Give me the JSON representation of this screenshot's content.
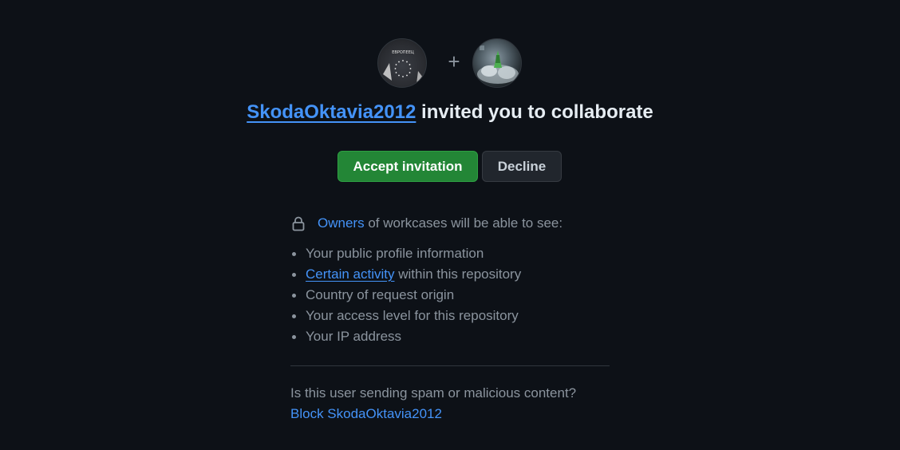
{
  "invite": {
    "inviter": "SkodaOktavia2012",
    "title_rest": "invited you to collaborate",
    "plus_symbol": "+",
    "inviter_avatar_text": "ЕВРОПЕЕЦ"
  },
  "actions": {
    "accept_label": "Accept invitation",
    "decline_label": "Decline"
  },
  "visibility": {
    "owners_link": "Owners",
    "owners_text": "of workcases will be able to see:",
    "items": [
      {
        "text": "Your public profile information"
      },
      {
        "link": "Certain activity",
        "text": "within this repository"
      },
      {
        "text": "Country of request origin"
      },
      {
        "text": "Your access level for this repository"
      },
      {
        "text": "Your IP address"
      }
    ]
  },
  "spam": {
    "question": "Is this user sending spam or malicious content?",
    "block_label": "Block SkodaOktavia2012"
  },
  "colors": {
    "background": "#0d1117",
    "link": "#4493f8",
    "accept_green": "#238636",
    "muted_text": "#8b949e",
    "heading_text": "#e6edf3"
  },
  "icons": {
    "lock": "lock-icon"
  }
}
